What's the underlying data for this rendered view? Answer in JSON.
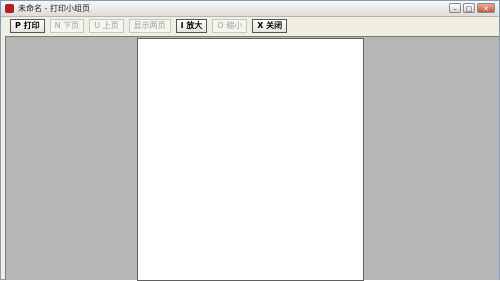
{
  "window": {
    "title": "未命名 - 打印小组页",
    "controls": {
      "minimize": "–",
      "maximize": "□",
      "close": "✕"
    }
  },
  "toolbar": {
    "buttons": [
      {
        "label": "P 打印",
        "enabled": true
      },
      {
        "label": "N 下页",
        "enabled": false
      },
      {
        "label": "U 上页",
        "enabled": false
      },
      {
        "label": "显示两页",
        "enabled": false
      },
      {
        "label": "I 放大",
        "enabled": true
      },
      {
        "label": "O 缩小",
        "enabled": false
      },
      {
        "label": "X 关闭",
        "enabled": true
      }
    ]
  },
  "colors": {
    "preview_background": "#b6b6b6",
    "page": "#ffffff",
    "frame": "#f1efe2"
  },
  "icons": {
    "app": "app-icon"
  }
}
